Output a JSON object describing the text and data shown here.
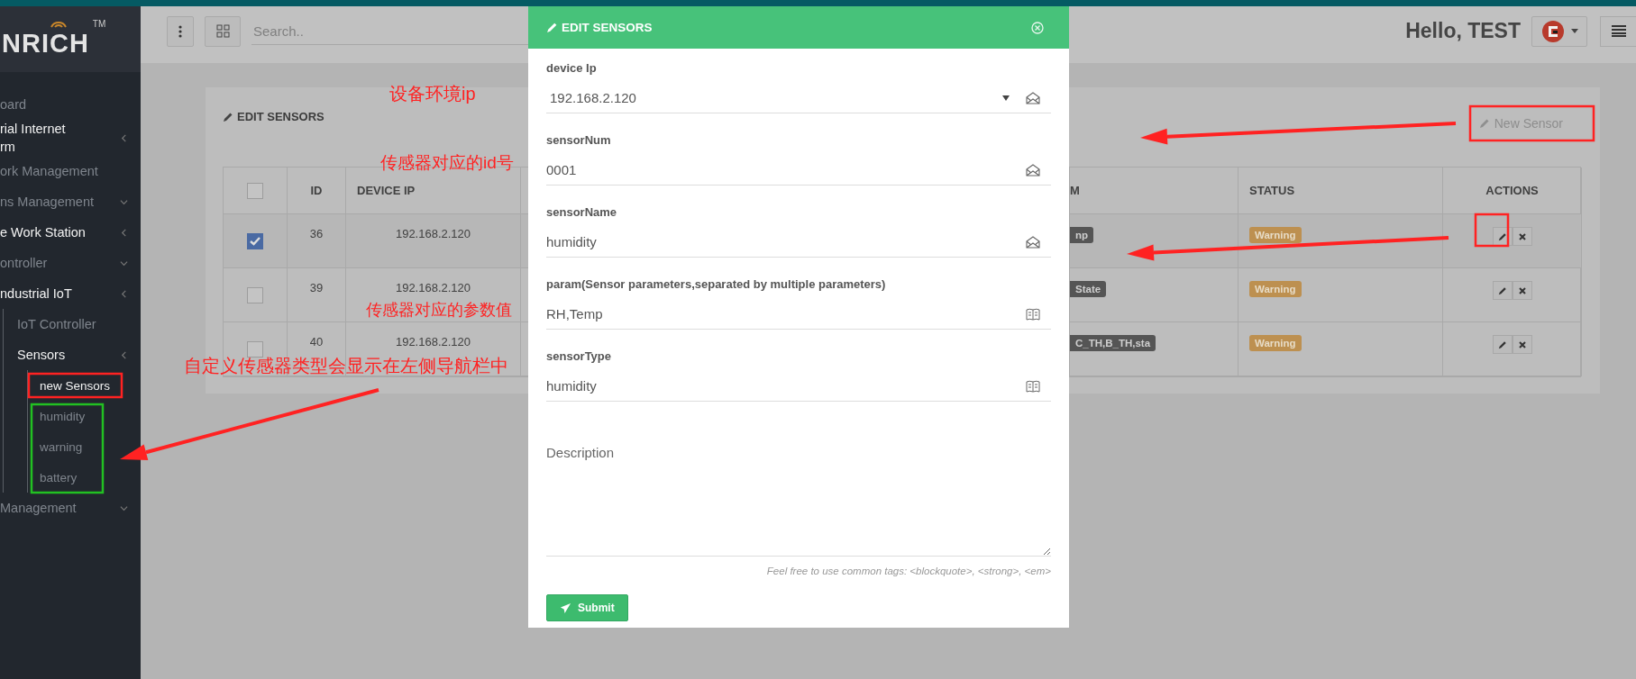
{
  "sidebar": {
    "logo": "NRICH",
    "logo_mark": "TM",
    "items": [
      {
        "label": "oard",
        "active": false
      },
      {
        "label": "rial Internet\nrm",
        "active": true,
        "expanded": true
      },
      {
        "label": "ork Management",
        "active": false
      },
      {
        "label": "ns Management",
        "active": false,
        "expanded": false
      },
      {
        "label": "e Work Station",
        "active": true,
        "expanded": true
      },
      {
        "label": "ontroller",
        "active": false,
        "expanded": false
      },
      {
        "label": "ndustrial IoT",
        "active": true,
        "expanded": true,
        "children": [
          {
            "label": "IoT Controller",
            "active": false
          },
          {
            "label": "Sensors",
            "active": true,
            "expanded": true,
            "children": [
              {
                "label": "new Sensors",
                "active": true
              },
              {
                "label": "humidity",
                "active": false
              },
              {
                "label": "warning",
                "active": false
              },
              {
                "label": "battery",
                "active": false
              }
            ]
          }
        ]
      },
      {
        "label": "Management",
        "active": false,
        "expanded": false
      }
    ]
  },
  "header": {
    "search_placeholder": "Search..",
    "greeting": "Hello, TEST"
  },
  "card": {
    "title": "EDIT SENSORS",
    "new_button": "New Sensor",
    "table": {
      "select_all": {
        "checked": false
      },
      "columns": [
        "ID",
        "DEVICE IP",
        "M",
        "STATUS",
        "ACTIONS"
      ],
      "rows": [
        {
          "checked": true,
          "id": "36",
          "ip": "192.168.2.120",
          "param": "np",
          "status": "Warning"
        },
        {
          "checked": false,
          "id": "39",
          "ip": "192.168.2.120",
          "param": "State",
          "status": "Warning"
        },
        {
          "checked": false,
          "id": "40",
          "ip": "192.168.2.120",
          "param": "C_TH,B_TH,sta",
          "status": "Warning"
        }
      ]
    }
  },
  "modal": {
    "title": "EDIT SENSORS",
    "fields": [
      {
        "label": "device Ip",
        "value": "192.168.2.120",
        "kind": "select"
      },
      {
        "label": "sensorNum",
        "value": "0001",
        "kind": "text"
      },
      {
        "label": "sensorName",
        "value": "humidity",
        "kind": "text"
      },
      {
        "label": "param(Sensor parameters,separated by multiple parameters)",
        "value": "RH,Temp",
        "kind": "list"
      },
      {
        "label": "sensorType",
        "value": "humidity",
        "kind": "list"
      }
    ],
    "description_placeholder": "Description",
    "hint": "Feel free to use common tags: <blockquote>, <strong>, <em>",
    "submit": "Submit"
  },
  "annotations": [
    {
      "text": "设备环境ip"
    },
    {
      "text": "传感器对应的id号"
    },
    {
      "text": "传感器对应的参数值"
    },
    {
      "text": "自定义传感器类型会显示在左侧导航栏中"
    }
  ]
}
